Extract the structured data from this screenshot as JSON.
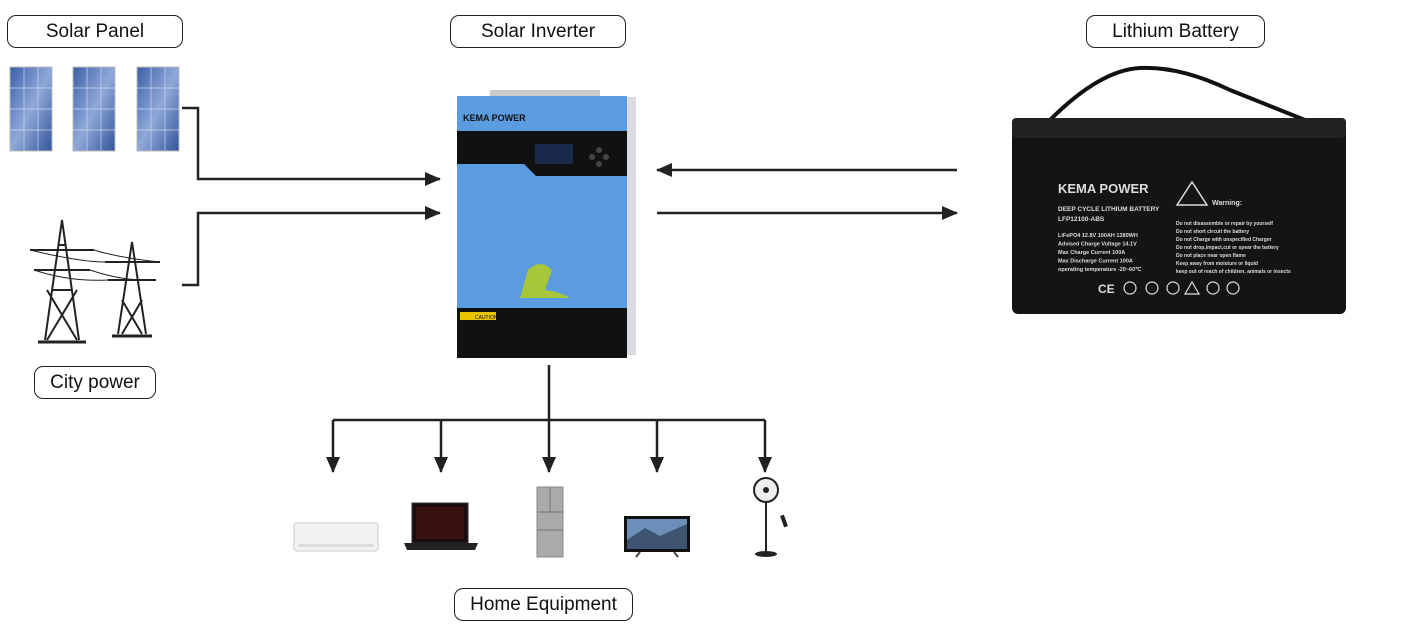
{
  "labels": {
    "solar_panel": "Solar Panel",
    "solar_inverter": "Solar Inverter",
    "lithium_battery": "Lithium Battery",
    "city_power": "City power",
    "home_equipment": "Home Equipment"
  },
  "inverter": {
    "brand": "KEMA POWER",
    "caution": "CAUTION",
    "color": "#5b9be0"
  },
  "battery": {
    "brand": "KEMA POWER",
    "type": "DEEP CYCLE LITHIUM BATTERY",
    "model": "LFP12100-ABS",
    "specs": [
      "LiFePO4 12.8V 100AH 1280WH",
      "Advised Charge Voltage 14.1V",
      "Max Charge Current 100A",
      "Max Discharge Current 100A",
      "operating temperature -20~60℃"
    ],
    "warning_title": "Warning:",
    "warnings": [
      "Do not disassemble or repair by yourself",
      "Do not short circuit the battery",
      "Do not Charge with unspecified Charger",
      "Do not drop,impact,cut or spear the battery",
      "Do not place near open flame",
      "Keep away from moisture or liquid",
      "keep out of reach of children, animals or insects"
    ],
    "marks": "CE"
  },
  "equipment": [
    "air-conditioner",
    "laptop",
    "refrigerator",
    "television",
    "electric-fan"
  ]
}
